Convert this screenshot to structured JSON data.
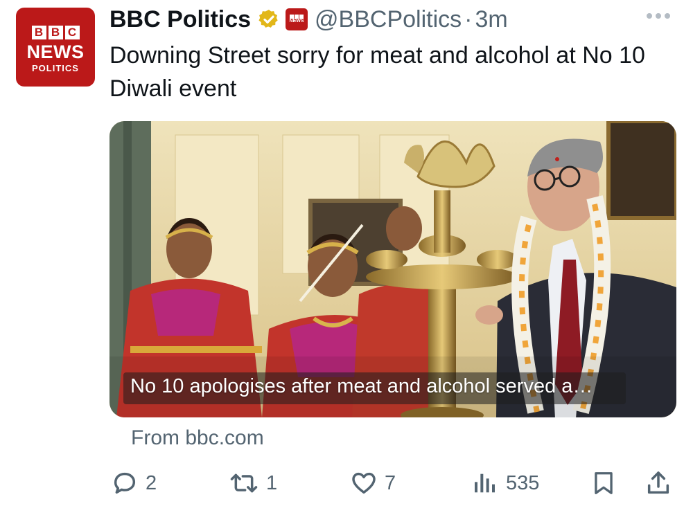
{
  "account": {
    "name": "BBC Politics",
    "handle": "@BBCPolitics",
    "separator": "·",
    "time": "3m",
    "avatar_blocks": [
      "B",
      "B",
      "C"
    ],
    "avatar_news": "NEWS",
    "avatar_politics": "POLITICS",
    "affiliate_text": "NEWS"
  },
  "tweet": {
    "text": "Downing Street sorry for meat and alcohol at No 10 Diwali event"
  },
  "media": {
    "caption": "No 10 apologises after meat and alcohol served a…"
  },
  "source": "From bbc.com",
  "actions": {
    "replies": "2",
    "reposts": "1",
    "likes": "7",
    "views": "535"
  },
  "icons": {
    "more": "more-horizontal-icon",
    "reply": "reply-icon",
    "repost": "repost-icon",
    "like": "heart-icon",
    "views": "views-icon",
    "bookmark": "bookmark-icon",
    "share": "share-icon",
    "verified": "verified-gold-badge-icon"
  },
  "colors": {
    "bbc_red": "#bb1919",
    "gold": "#e2b719",
    "secondary_text": "#536471"
  }
}
